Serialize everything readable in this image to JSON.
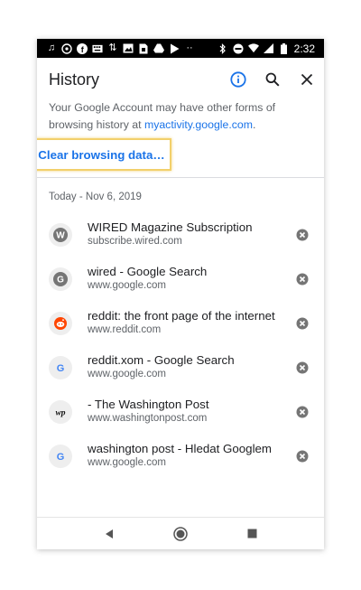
{
  "statusbar": {
    "time": "2:32"
  },
  "appbar": {
    "title": "History"
  },
  "info": {
    "text": "Your Google Account may have other forms of browsing history at",
    "link": "myactivity.google.com",
    "end": "."
  },
  "clear_button": "Clear browsing data…",
  "date_header": "Today - Nov 6, 2019",
  "items": [
    {
      "title": "WIRED Magazine Subscription",
      "url": "subscribe.wired.com",
      "favicon": "W"
    },
    {
      "title": "wired - Google Search",
      "url": "www.google.com",
      "favicon": "G"
    },
    {
      "title": "reddit: the front page of the internet",
      "url": "www.reddit.com",
      "favicon": "reddit-icon"
    },
    {
      "title": "reddit.xom - Google Search",
      "url": "www.google.com",
      "favicon": "G"
    },
    {
      "title": "- The Washington Post",
      "url": "www.washingtonpost.com",
      "favicon": "wp"
    },
    {
      "title": "washington post - Hledat Googlem",
      "url": "www.google.com",
      "favicon": "G"
    }
  ],
  "colors": {
    "accent": "#1a73e8",
    "highlight": "#f2d06b"
  }
}
